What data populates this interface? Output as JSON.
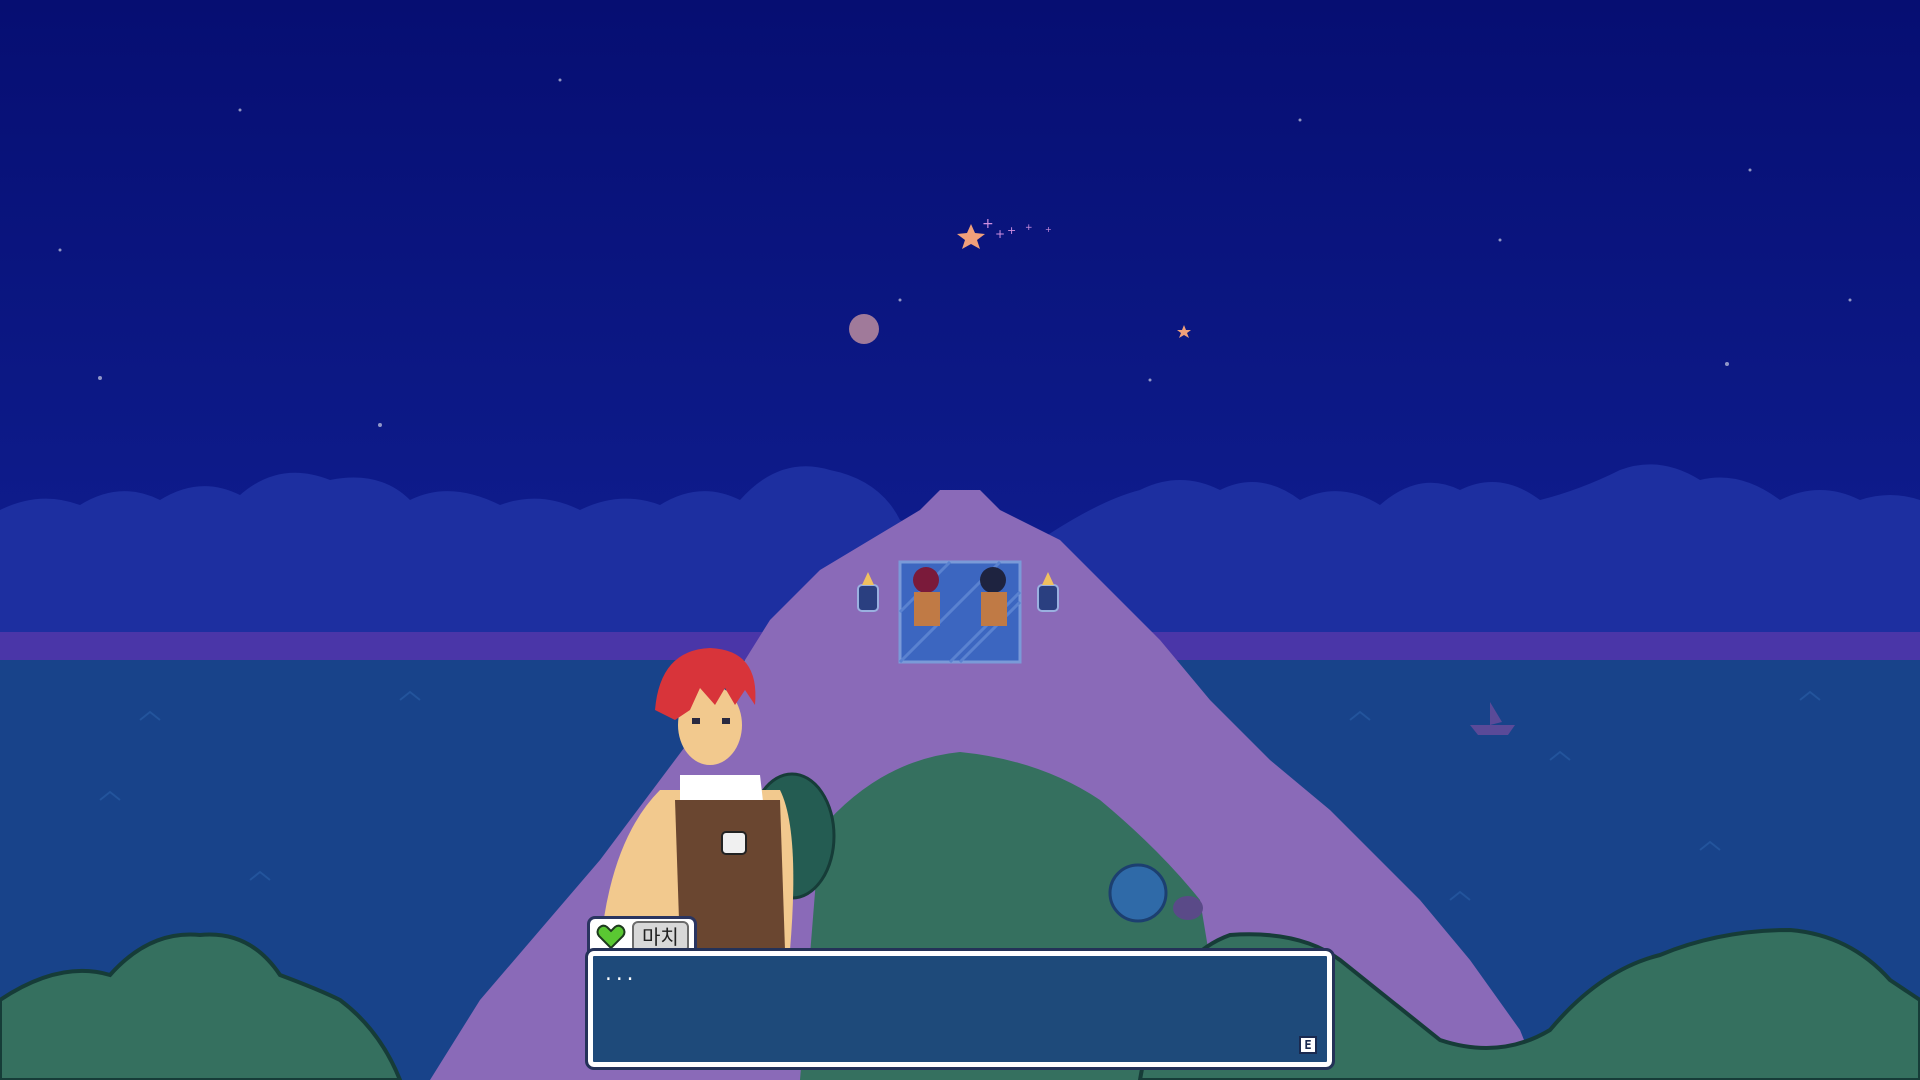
{
  "dialog": {
    "speaker_name": "마치",
    "speaker_icon": "green-heart-icon",
    "text": "...",
    "advance_key": "E",
    "box_color": "#1e4a7a"
  },
  "scene": {
    "sky_color": "#07107a",
    "cloud_color": "#1d2fa0",
    "sea_color": "#18438a",
    "hill_color": "#8a6ab8",
    "grass_color": "#35705f"
  }
}
